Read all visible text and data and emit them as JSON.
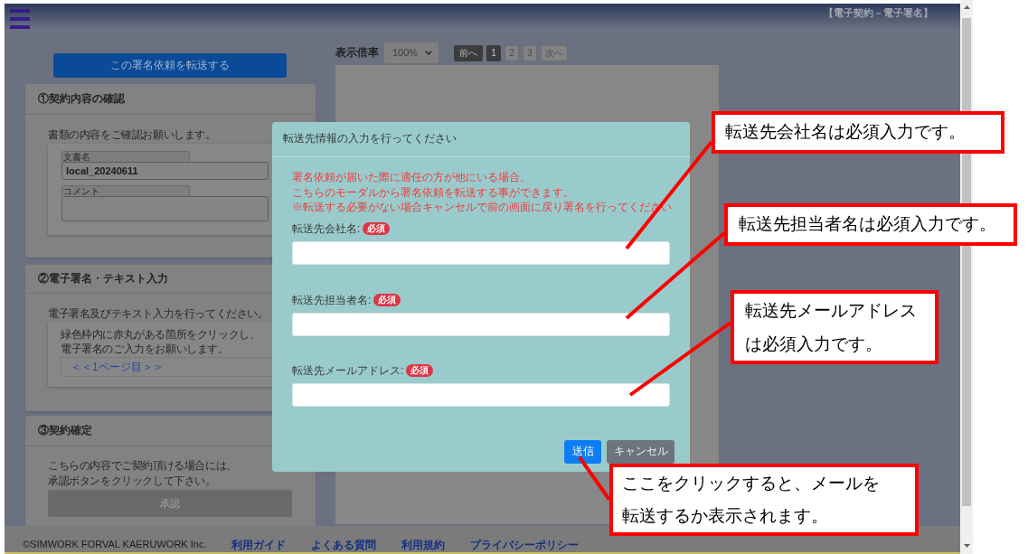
{
  "header": {
    "title": "【電子契約－電子署名】"
  },
  "forward_button": {
    "label": "この署名依頼を転送する"
  },
  "sections": [
    {
      "kind": "document",
      "title": "①契約内容の確認",
      "intro": "書類の内容をご確認お願いします。",
      "fields": [
        {
          "kind": "input",
          "label": "文書名",
          "value": "local_20240611"
        },
        {
          "kind": "textarea",
          "label": "コメント"
        }
      ]
    },
    {
      "kind": "signature",
      "title": "②電子署名・テキスト入力",
      "intro": "電子署名及びテキスト入力を行ってください。",
      "lines": [
        "緑色枠内に赤丸がある箇所をクリックし、",
        "電子署名のご入力をお願いします。"
      ],
      "link": "＜＜1ページ目＞＞"
    },
    {
      "kind": "confirm",
      "title": "③契約確定",
      "lines": [
        "こちらの内容でご契約頂ける場合には、",
        "承認ボタンをクリックして下さい。"
      ],
      "button": "承認"
    }
  ],
  "viewer": {
    "zoom_label": "表示倍率",
    "zoom_value": "100%",
    "prev": "前へ",
    "pages": [
      {
        "label": "1",
        "selected": true
      },
      {
        "label": "2",
        "selected": false
      },
      {
        "label": "3",
        "selected": false
      }
    ],
    "next": "次へ"
  },
  "modal": {
    "title": "転送先情報の入力を行ってください",
    "notice": [
      "署名依頼が届いた際に適任の方が他にいる場合、",
      "こちらのモーダルから署名依頼を転送する事ができます。",
      "※転送する必要がない場合キャンセルで前の画面に戻り署名を行ってください"
    ],
    "fields": [
      {
        "label": "転送先会社名:",
        "badge": "必須"
      },
      {
        "label": "転送先担当者名:",
        "badge": "必須"
      },
      {
        "label": "転送先メールアドレス:",
        "badge": "必須"
      }
    ],
    "buttons": [
      {
        "kind": "primary",
        "label": "送信"
      },
      {
        "kind": "secondary",
        "label": "キャンセル"
      }
    ]
  },
  "footer": {
    "copyright": "©SIMWORK FORVAL KAERUWORK Inc.",
    "links": [
      "利用ガイド",
      "よくある質問",
      "利用規約",
      "プライバシーポリシー"
    ]
  },
  "callouts": [
    {
      "text": "転送先会社名は必須入力です。"
    },
    {
      "text": "転送先担当者名は必須入力です。"
    },
    {
      "text": "転送先メールアドレスは必須入力です。"
    },
    {
      "text": "ここをクリックすると、メールを転送するか表示されます。"
    }
  ]
}
